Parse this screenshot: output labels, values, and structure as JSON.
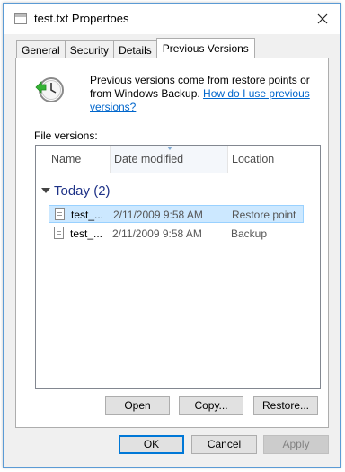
{
  "window": {
    "title": "test.txt Propertoes"
  },
  "tabs": [
    {
      "label": "General"
    },
    {
      "label": "Security"
    },
    {
      "label": "Details"
    },
    {
      "label": "Previous Versions"
    }
  ],
  "panel": {
    "intro_text": "Previous versions come from restore points or from Windows Backup. ",
    "intro_link": "How do I use previous versions?",
    "file_versions_label": "File versions:",
    "columns": {
      "name": "Name",
      "date": "Date modified",
      "location": "Location"
    },
    "group": {
      "title": "Today (2)"
    },
    "rows": [
      {
        "name": "test_...",
        "date": "2/11/2009 9:58 AM",
        "location": "Restore point",
        "selected": true
      },
      {
        "name": "test_...",
        "date": "2/11/2009 9:58 AM",
        "location": "Backup",
        "selected": false
      }
    ],
    "actions": {
      "open": "Open",
      "copy": "Copy...",
      "restore": "Restore..."
    }
  },
  "footer": {
    "ok": "OK",
    "cancel": "Cancel",
    "apply": "Apply"
  },
  "icons": {
    "clock": "clock-with-green-arrow-icon",
    "file": "text-file-icon",
    "close": "close-icon"
  }
}
